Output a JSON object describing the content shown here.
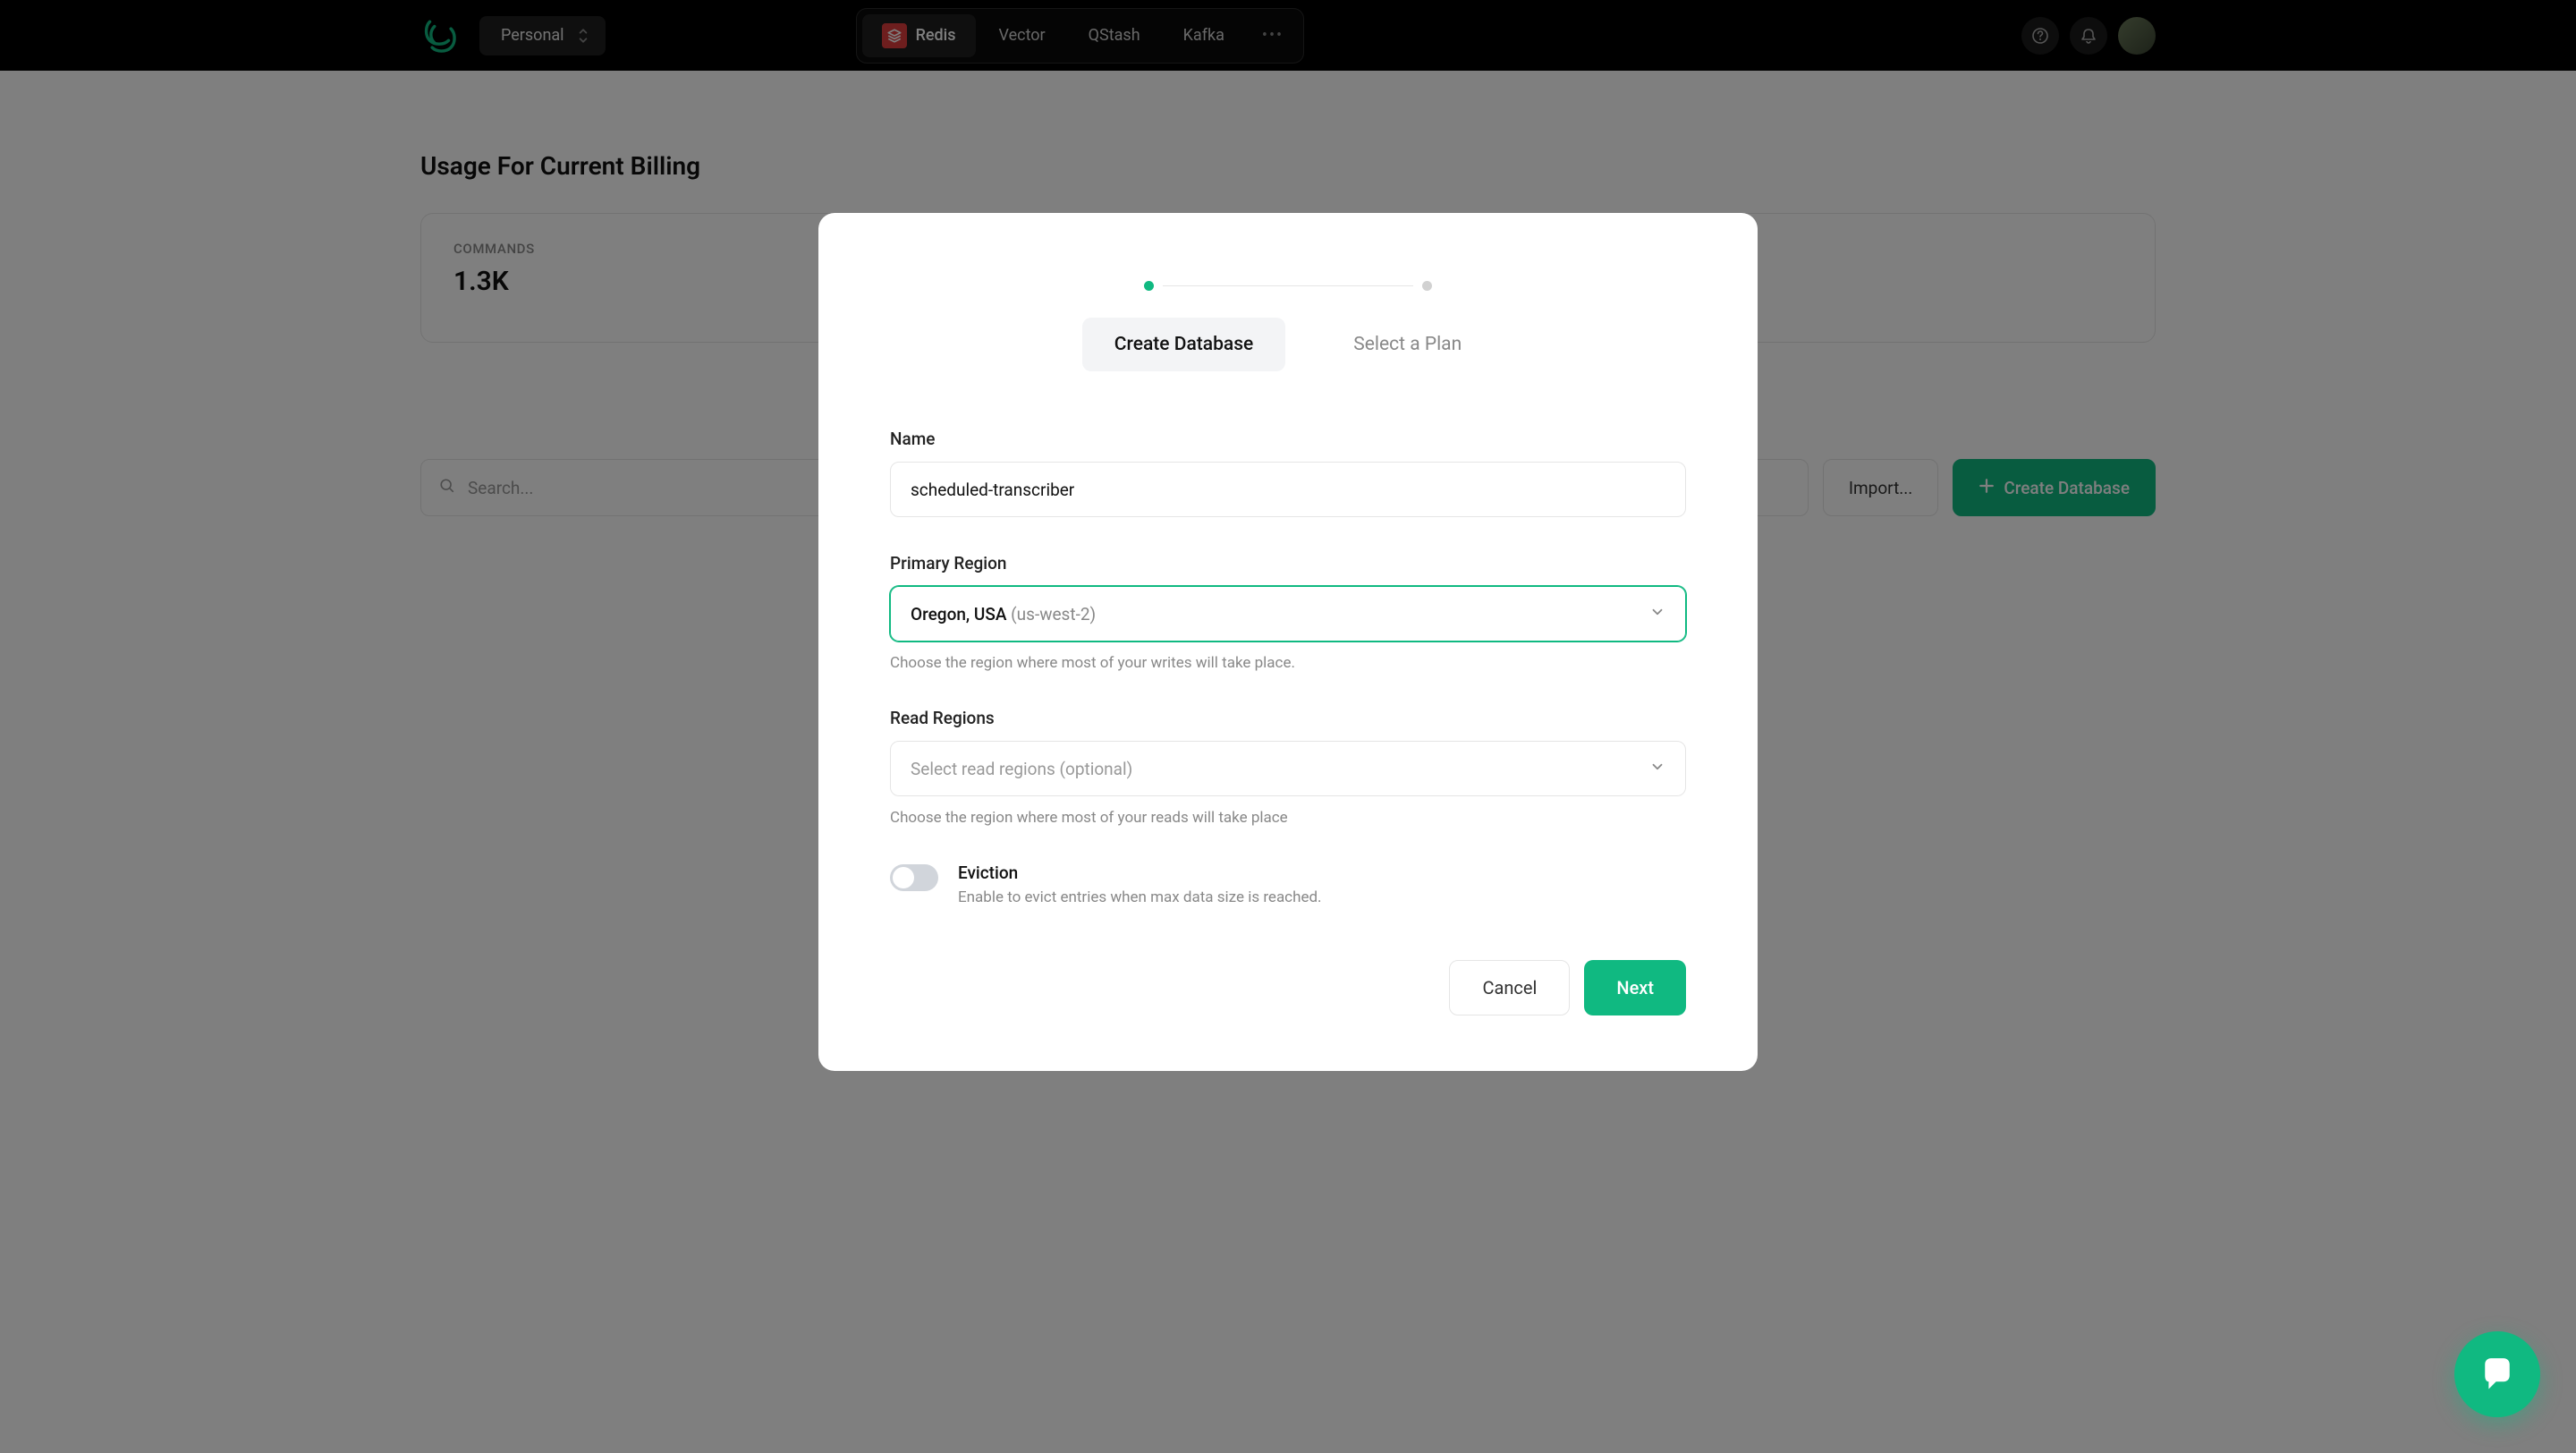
{
  "topbar": {
    "account": "Personal",
    "nav": {
      "redis": "Redis",
      "vector": "Vector",
      "qstash": "QStash",
      "kafka": "Kafka"
    }
  },
  "usage": {
    "title": "Usage For Current Billing",
    "commands_label": "COMMANDS",
    "commands_value": "1.3K"
  },
  "actions": {
    "search_placeholder": "Search...",
    "import_label": "Import...",
    "create_label": "Create Database"
  },
  "modal": {
    "steps": {
      "create": "Create Database",
      "plan": "Select a Plan"
    },
    "name": {
      "label": "Name",
      "value": "scheduled-transcriber"
    },
    "primary_region": {
      "label": "Primary Region",
      "selected_prefix": "Oregon, USA ",
      "selected_suffix": "(us-west-2)",
      "help": "Choose the region where most of your writes will take place."
    },
    "read_regions": {
      "label": "Read Regions",
      "placeholder": "Select read regions (optional)",
      "help": "Choose the region where most of your reads will take place"
    },
    "eviction": {
      "title": "Eviction",
      "desc": "Enable to evict entries when max data size is reached."
    },
    "buttons": {
      "cancel": "Cancel",
      "next": "Next"
    }
  }
}
